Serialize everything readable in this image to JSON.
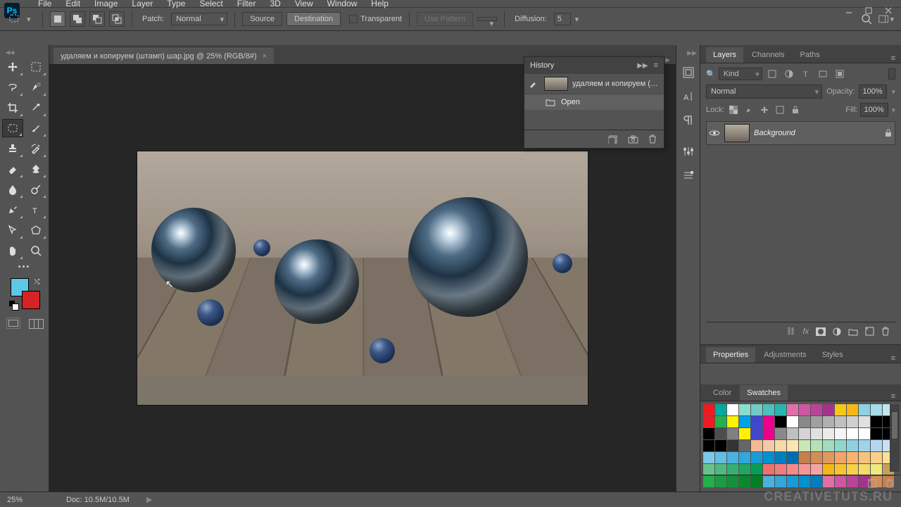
{
  "menus": [
    "File",
    "Edit",
    "Image",
    "Layer",
    "Type",
    "Select",
    "Filter",
    "3D",
    "View",
    "Window",
    "Help"
  ],
  "options": {
    "patch_label": "Patch:",
    "patch_mode": "Normal",
    "source": "Source",
    "destination": "Destination",
    "transparent": "Transparent",
    "use_pattern": "Use Pattern",
    "diffusion_label": "Diffusion:",
    "diffusion_value": "5"
  },
  "document": {
    "tab_title": "удаляем и копируем (штамп) шар.jpg @ 25% (RGB/8#)"
  },
  "history": {
    "title": "History",
    "doc_name": "удаляем и копируем (…",
    "steps": [
      {
        "label": "Open"
      }
    ]
  },
  "layers_panel": {
    "tabs": [
      "Layers",
      "Channels",
      "Paths"
    ],
    "filter_kind": "Kind",
    "blend_mode": "Normal",
    "opacity_label": "Opacity:",
    "opacity_value": "100%",
    "lock_label": "Lock:",
    "fill_label": "Fill:",
    "fill_value": "100%",
    "layer_name": "Background"
  },
  "properties_panel": {
    "tabs": [
      "Properties",
      "Adjustments",
      "Styles"
    ]
  },
  "swatches_panel": {
    "tabs": [
      "Color",
      "Swatches"
    ],
    "colors": [
      "#ed1c24",
      "#00a99d",
      "#ffffff",
      "#8cdccf",
      "#72cbc4",
      "#4cc1bb",
      "#27b5b0",
      "#e170a8",
      "#cd57a0",
      "#b94399",
      "#a6328f",
      "#f7c816",
      "#f5b816",
      "#8ed1e1",
      "#a6dbe8",
      "#c3e7ef",
      "#ed1c24",
      "#22b14c",
      "#fff200",
      "#00a2e8",
      "#3f48cc",
      "#ec008c",
      "#000000",
      "#ffffff",
      "#898989",
      "#a0a0a0",
      "#b0b0b0",
      "#c0c0c0",
      "#d0d0d0",
      "#e0e0e0",
      "#000000",
      "#000000",
      "#000000",
      "#4d4d4d",
      "#808080",
      "#fff200",
      "#3f48cc",
      "#ec008c",
      "#898989",
      "#c0c0c0",
      "#d4d4d4",
      "#e0e0e0",
      "#ebebeb",
      "#f5f5f5",
      "#ffffff",
      "#ffffff",
      "#000000",
      "#000000",
      "#000000",
      "#000000",
      "#333333",
      "#666666",
      "#f8b890",
      "#f5c9a4",
      "#f9d9a6",
      "#fbe6b2",
      "#c7e8b6",
      "#b3e2b3",
      "#a0ddc0",
      "#8ed7cd",
      "#8ed1e1",
      "#9ed4ec",
      "#b0d8f1",
      "#c6e1f5",
      "#7cc8e8",
      "#63bde3",
      "#4ab2df",
      "#31a7da",
      "#189cd6",
      "#0091d1",
      "#007fc0",
      "#006eae",
      "#c77f4d",
      "#d58c55",
      "#e3995d",
      "#f1a665",
      "#f7b46e",
      "#f9c27a",
      "#fbd087",
      "#fdde93",
      "#67c18c",
      "#4fb87e",
      "#37af70",
      "#1fa662",
      "#079d54",
      "#ef6f6f",
      "#f17c7c",
      "#f38989",
      "#f59696",
      "#f7a3a3",
      "#f6b816",
      "#f5c431",
      "#f4d04c",
      "#f3dc67",
      "#f2e882",
      "#c1a35b",
      "#22b14c",
      "#1a9c42",
      "#129238",
      "#0a882e",
      "#027e24",
      "#4ab2df",
      "#31a7da",
      "#189cd6",
      "#0091d1",
      "#007fc0",
      "#e170a8",
      "#cd57a0",
      "#b94399",
      "#a6328f",
      "#d58c55",
      "#c77f4d"
    ]
  },
  "status": {
    "zoom": "25%",
    "doc_info": "Doc: 10.5M/10.5M"
  },
  "watermark": "CREATIVETUTS.RU",
  "colors": {
    "foreground": "#5ec7e8",
    "background": "#d62424"
  }
}
